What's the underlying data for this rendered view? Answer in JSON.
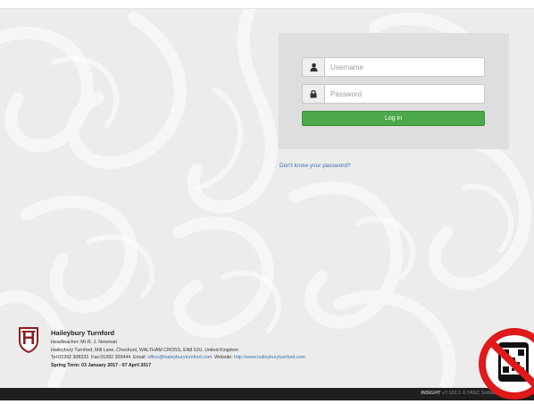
{
  "login": {
    "username_placeholder": "Username",
    "password_placeholder": "Password",
    "login_label": "Log in",
    "forgot_link": "Don't know your password?"
  },
  "school": {
    "name": "Haileybury Turnford",
    "headteacher": "Headteacher: Mr R. J. Newman",
    "address": "Haileybury Turnford, Mill Lane, Cheshunt, WALTHAM CROSS, EN8 0JU, United Kingdom",
    "tel_fax": "Tel:01992 308333  Fax:01992 309444  Email:",
    "email": "office@haileyburyturnford.com",
    "website_label": " Website:",
    "website": "http://www.haileyburyturnford.com",
    "term": "Spring Term: 03 January 2017 - 07 April 2017"
  },
  "footer": {
    "product": "INSIGHT",
    "version_text": "v7.102.1 © TASC Software Solutions Ltd"
  },
  "colors": {
    "login_button": "#4ca84a",
    "link": "#3a6fb0",
    "footer_bg": "#1f1f1f",
    "qr_badge_ring": "#e01919"
  },
  "icons": {
    "username": "user-icon",
    "password": "lock-icon",
    "crest": "school-crest-icon",
    "qr": "qr-badge-icon"
  }
}
